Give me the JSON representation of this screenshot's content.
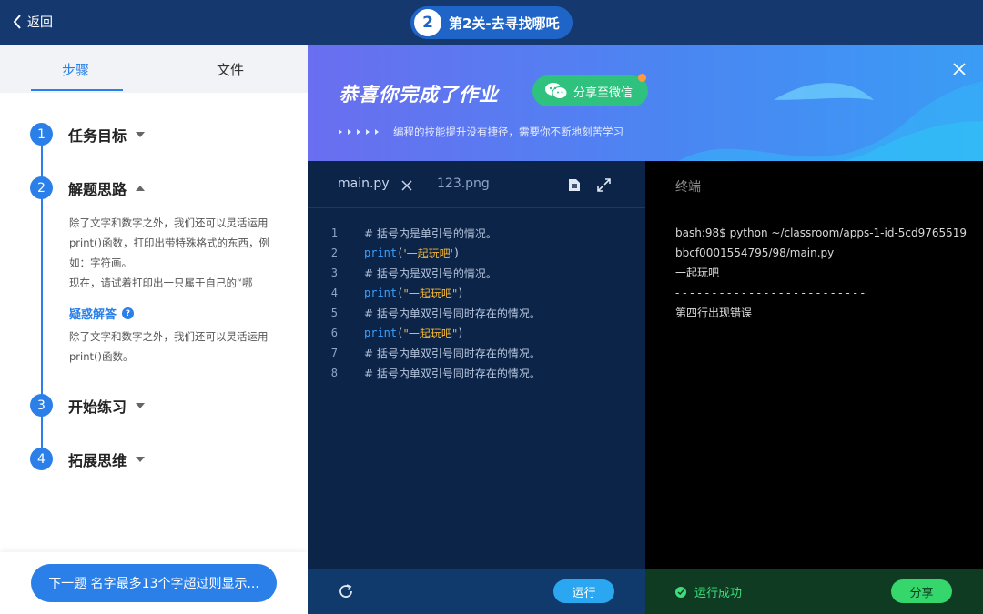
{
  "topbar": {
    "back_label": "返回",
    "level_number": "2",
    "level_title": "第2关-去寻找哪吒"
  },
  "left": {
    "tabs": [
      "步骤",
      "文件"
    ],
    "active_tab": "步骤",
    "steps": [
      {
        "num": "1",
        "title": "任务目标",
        "expanded": false
      },
      {
        "num": "2",
        "title": "解题思路",
        "expanded": true
      },
      {
        "num": "3",
        "title": "开始练习",
        "expanded": false
      },
      {
        "num": "4",
        "title": "拓展思维",
        "expanded": false
      }
    ],
    "step2_paragraph_1": "除了文字和数字之外，我们还可以灵活运用print()函数，打印出带特殊格式的东西，例如：字符画。",
    "step2_paragraph_2": "现在，请试着打印出一只属于自己的“哪",
    "faq_label": "疑惑解答",
    "faq_text": "除了文字和数字之外，我们还可以灵活运用print()函数。",
    "next_button": "下一题  名字最多13个字超过则显示..."
  },
  "banner": {
    "title": "恭喜你完成了作业",
    "share_label": "分享至微信",
    "subtitle": "编程的技能提升没有捷径，需要你不断地刻苦学习"
  },
  "editor": {
    "tabs": [
      "main.py",
      "123.png"
    ],
    "active_tab": "main.py",
    "lines": [
      {
        "n": "1",
        "comment": "# 括号内是单引号的情况。"
      },
      {
        "n": "2",
        "fn": "print",
        "open": "(",
        "str": "'一起玩吧'",
        "close": ")"
      },
      {
        "n": "3",
        "comment": "# 括号内是双引号的情况。"
      },
      {
        "n": "4",
        "fn": "print",
        "open": "(",
        "str": "\"一起玩吧\"",
        "close": ")"
      },
      {
        "n": "5",
        "comment": "# 括号内单双引号同时存在的情况。"
      },
      {
        "n": "6",
        "fn": "print",
        "open": "(",
        "str": "\"一起玩吧\"",
        "close": ")"
      },
      {
        "n": "7",
        "comment": "# 括号内单双引号同时存在的情况。"
      },
      {
        "n": "8",
        "comment": "# 括号内单双引号同时存在的情况。"
      }
    ],
    "run_label": "运行"
  },
  "terminal": {
    "title": "终端",
    "output": [
      "bash:98$ python ~/classroom/apps-1-id-5cd9765519bbcf0001554795/98/main.py",
      "一起玩吧",
      "- - - - - - - - - - - - - - - - - - - - - - - - - -",
      "第四行出现错误"
    ],
    "status_label": "运行成功",
    "share_label": "分享"
  },
  "colors": {
    "primary": "#2a7fe8",
    "success": "#3be07a",
    "editor_bg": "#0c2448",
    "terminal_bg": "#000000",
    "wechat_green": "#2ec27e"
  },
  "icons": [
    "chevron-left-icon",
    "wechat-icon",
    "close-icon",
    "file-icon",
    "expand-icon",
    "refresh-icon",
    "check-icon",
    "question-icon",
    "caret-down-icon",
    "caret-up-icon"
  ]
}
